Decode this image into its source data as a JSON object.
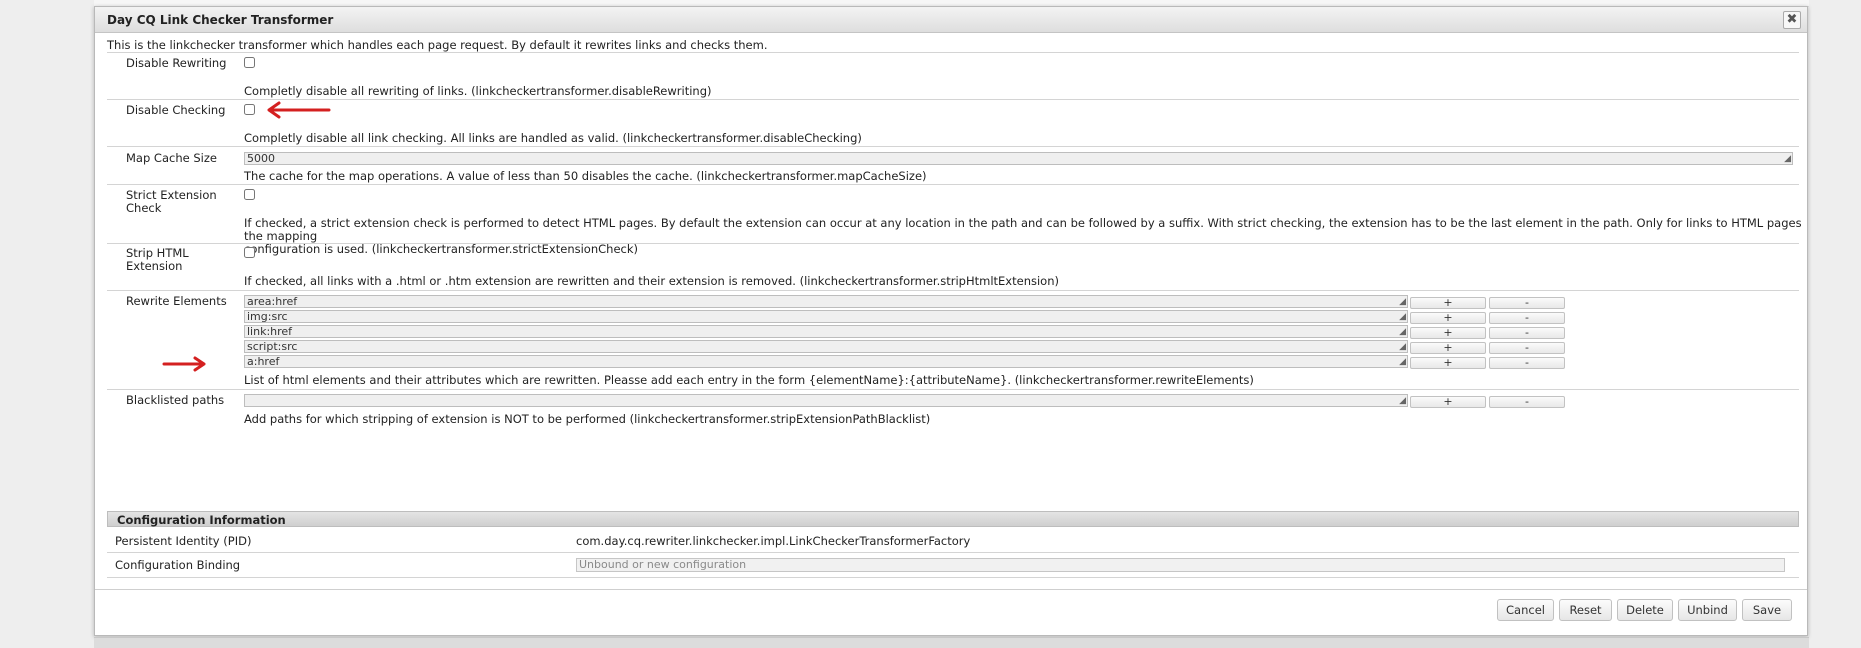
{
  "dialog": {
    "title": "Day CQ Link Checker Transformer",
    "close_icon": "✖",
    "intro": "This is the linkchecker transformer which handles each page request. By default it rewrites links and checks them."
  },
  "fields": {
    "disable_rewriting": {
      "label": "Disable Rewriting",
      "checked": false,
      "description": "Completly disable all rewriting of links. (linkcheckertransformer.disableRewriting)"
    },
    "disable_checking": {
      "label": "Disable Checking",
      "checked": false,
      "description": "Completly disable all link checking. All links are handled as valid. (linkcheckertransformer.disableChecking)"
    },
    "map_cache_size": {
      "label": "Map Cache Size",
      "value": "5000",
      "description": "The cache for the map operations. A value of less than 50 disables the cache. (linkcheckertransformer.mapCacheSize)"
    },
    "strict_extension_check": {
      "label_line1": "Strict Extension",
      "label_line2": "Check",
      "checked": false,
      "description_line1": "If checked, a strict extension check is performed to detect HTML pages. By default the extension can occur at any location in the path and can be followed by a suffix. With strict checking, the extension has to be the last element in the path. Only for links to HTML pages the mapping",
      "description_line2": "configuration is used. (linkcheckertransformer.strictExtensionCheck)"
    },
    "strip_html_extension": {
      "label_line1": "Strip HTML",
      "label_line2": "Extension",
      "checked": false,
      "description": "If checked, all links with a .html or .htm extension are rewritten and their extension is removed. (linkcheckertransformer.stripHtmltExtension)"
    },
    "rewrite_elements": {
      "label": "Rewrite Elements",
      "values": [
        "area:href",
        "img:src",
        "link:href",
        "script:src",
        "a:href"
      ],
      "description": "List of html elements and their attributes which are rewritten. Pleasse add each entry in the form {elementName}:{attributeName}. (linkcheckertransformer.rewriteElements)"
    },
    "blacklisted_paths": {
      "label": "Blacklisted paths",
      "value": "",
      "description": "Add paths for which stripping of extension is NOT to be performed (linkcheckertransformer.stripExtensionPathBlacklist)"
    },
    "add_label": "+",
    "remove_label": "-"
  },
  "config_info": {
    "title": "Configuration Information",
    "pid_label": "Persistent Identity (PID)",
    "pid_value": "com.day.cq.rewriter.linkchecker.impl.LinkCheckerTransformerFactory",
    "binding_label": "Configuration Binding",
    "binding_placeholder": "Unbound or new configuration"
  },
  "buttons": {
    "cancel": "Cancel",
    "reset": "Reset",
    "delete": "Delete",
    "unbind": "Unbind",
    "save": "Save"
  },
  "annotations": {
    "arrow_color": "#d42020",
    "arrow_icon": "red-arrow-icon"
  }
}
